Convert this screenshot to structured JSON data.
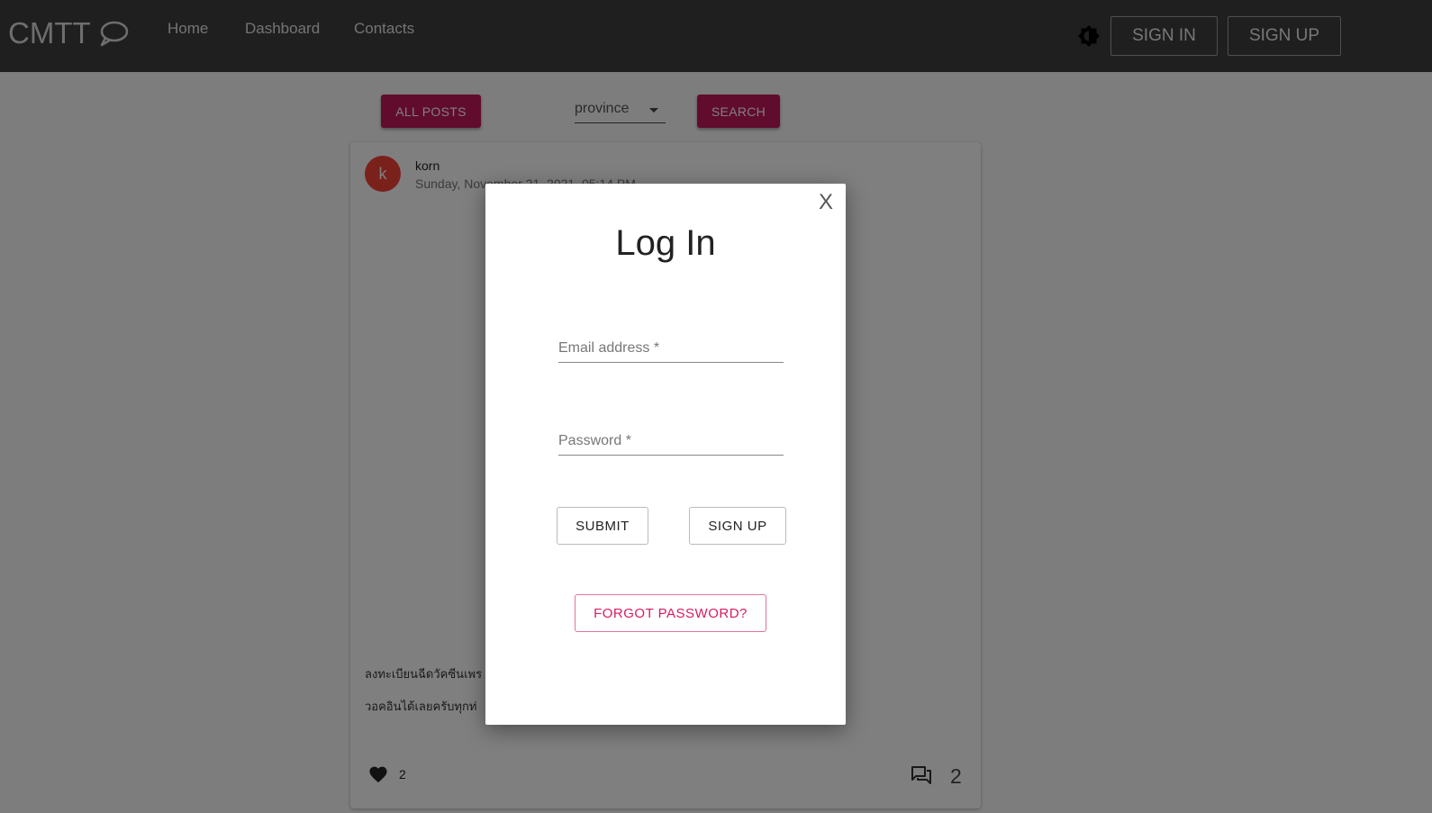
{
  "header": {
    "brand": "CMTT",
    "nav": [
      "Home",
      "Dashboard",
      "Contacts"
    ],
    "sign_in_label": "SIGN IN",
    "sign_up_label": "SIGN UP",
    "theme_icon": "brightness-icon"
  },
  "filters": {
    "all_posts_label": "ALL POSTS",
    "province_value": "province",
    "search_label": "SEARCH"
  },
  "post": {
    "avatar_letter": "k",
    "author": "korn",
    "date": "Sunday, November 21, 2021, 05:14 PM",
    "lines": [
      "ลงทะเบียนฉีดวัคซีนเพร",
      "วอคอินได้เลยครับทุกท่"
    ],
    "likes": "2",
    "comments": "2"
  },
  "login_modal": {
    "close_label": "X",
    "title": "Log In",
    "email_label": "Email address *",
    "password_label": "Password *",
    "submit_label": "SUBMIT",
    "sign_up_label": "SIGN UP",
    "forgot_label": "FORGOT PASSWORD?"
  },
  "colors": {
    "appbar": "#3f3f3f",
    "accent": "#c2185b",
    "avatar": "#f44336"
  }
}
